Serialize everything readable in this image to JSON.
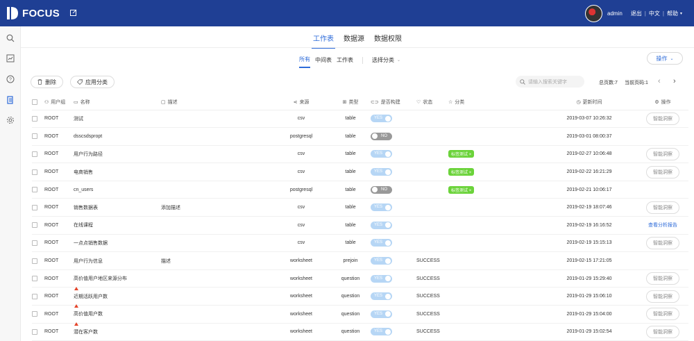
{
  "app": {
    "logo": "FOCUS",
    "user": "admin",
    "links": [
      "退出",
      "中文",
      "帮助"
    ]
  },
  "sidebar": [
    "search-icon",
    "dashboard-icon",
    "help-icon",
    "worksheet-icon",
    "settings-icon"
  ],
  "tabs": [
    "工作表",
    "数据源",
    "数据权限"
  ],
  "subtabs": [
    "所有",
    "中间表",
    "工作表"
  ],
  "filter_label": "选择分类",
  "action_label": "操作",
  "toolbar": {
    "delete_label": "删除",
    "apply_category_label": "应用分类",
    "search_placeholder": "请输入搜索关键字",
    "total_pages": "总页数:7",
    "current_page": "当前页码:1"
  },
  "columns": {
    "group": "用户组",
    "name": "名称",
    "desc": "描述",
    "source": "来源",
    "type": "类型",
    "built": "是否构建",
    "status": "状态",
    "category": "分类",
    "updated": "更新时间",
    "ops": "操作"
  },
  "rows": [
    {
      "group": "ROOT",
      "name": "测试",
      "desc": "",
      "source": "csv",
      "type": "table",
      "built": "YES",
      "status": "",
      "tag": "",
      "updated": "2019-03-07 10:26:32",
      "op": "智能洞察",
      "op_kind": "button",
      "hot": false
    },
    {
      "group": "ROOT",
      "name": "dsscsdspropt",
      "desc": "",
      "source": "postgresql",
      "type": "table",
      "built": "NO",
      "status": "",
      "tag": "",
      "updated": "2019-03-01 08:00:37",
      "op": "",
      "op_kind": "none",
      "hot": false
    },
    {
      "group": "ROOT",
      "name": "用户行为路径",
      "desc": "",
      "source": "csv",
      "type": "table",
      "built": "YES",
      "status": "",
      "tag": "标签测试",
      "updated": "2019-02-27 10:06:48",
      "op": "智能洞察",
      "op_kind": "button",
      "hot": false
    },
    {
      "group": "ROOT",
      "name": "电商销售",
      "desc": "",
      "source": "csv",
      "type": "table",
      "built": "YES",
      "status": "",
      "tag": "标签测试",
      "updated": "2019-02-22 16:21:29",
      "op": "智能洞察",
      "op_kind": "button",
      "hot": false
    },
    {
      "group": "ROOT",
      "name": "cn_users",
      "desc": "",
      "source": "postgresql",
      "type": "table",
      "built": "NO",
      "status": "",
      "tag": "标签测试",
      "updated": "2019-02-21 10:06:17",
      "op": "",
      "op_kind": "none",
      "hot": false
    },
    {
      "group": "ROOT",
      "name": "销售数据表",
      "desc": "添加描述",
      "source": "csv",
      "type": "table",
      "built": "YES",
      "status": "",
      "tag": "",
      "updated": "2019-02-19 18:07:46",
      "op": "智能洞察",
      "op_kind": "button",
      "hot": false
    },
    {
      "group": "ROOT",
      "name": "在线课程",
      "desc": "",
      "source": "csv",
      "type": "table",
      "built": "YES",
      "status": "",
      "tag": "",
      "updated": "2019-02-19 16:16:52",
      "op": "查看分析报告",
      "op_kind": "link",
      "hot": false
    },
    {
      "group": "ROOT",
      "name": "一点点销售数据",
      "desc": "",
      "source": "csv",
      "type": "table",
      "built": "YES",
      "status": "",
      "tag": "",
      "updated": "2019-02-19 15:15:13",
      "op": "智能洞察",
      "op_kind": "button",
      "hot": false
    },
    {
      "group": "ROOT",
      "name": "用户行为信息",
      "desc": "描述",
      "source": "worksheet",
      "type": "prejoin",
      "built": "YES",
      "status": "SUCCESS",
      "tag": "",
      "updated": "2019-02-15 17:21:05",
      "op": "",
      "op_kind": "none",
      "hot": false
    },
    {
      "group": "ROOT",
      "name": "高价值用户地区来源分布",
      "desc": "",
      "source": "worksheet",
      "type": "question",
      "built": "YES",
      "status": "SUCCESS",
      "tag": "",
      "updated": "2019-01-29 15:29:40",
      "op": "智能洞察",
      "op_kind": "button",
      "hot": false
    },
    {
      "group": "ROOT",
      "name": "近期活跃用户数",
      "desc": "",
      "source": "worksheet",
      "type": "question",
      "built": "YES",
      "status": "SUCCESS",
      "tag": "",
      "updated": "2019-01-29 15:06:10",
      "op": "智能洞察",
      "op_kind": "button",
      "hot": true
    },
    {
      "group": "ROOT",
      "name": "高价值用户数",
      "desc": "",
      "source": "worksheet",
      "type": "question",
      "built": "YES",
      "status": "SUCCESS",
      "tag": "",
      "updated": "2019-01-29 15:04:00",
      "op": "智能洞察",
      "op_kind": "button",
      "hot": true
    },
    {
      "group": "ROOT",
      "name": "潜在客户数",
      "desc": "",
      "source": "worksheet",
      "type": "question",
      "built": "YES",
      "status": "SUCCESS",
      "tag": "",
      "updated": "2019-01-29 15:02:54",
      "op": "智能洞察",
      "op_kind": "button",
      "hot": true
    }
  ]
}
